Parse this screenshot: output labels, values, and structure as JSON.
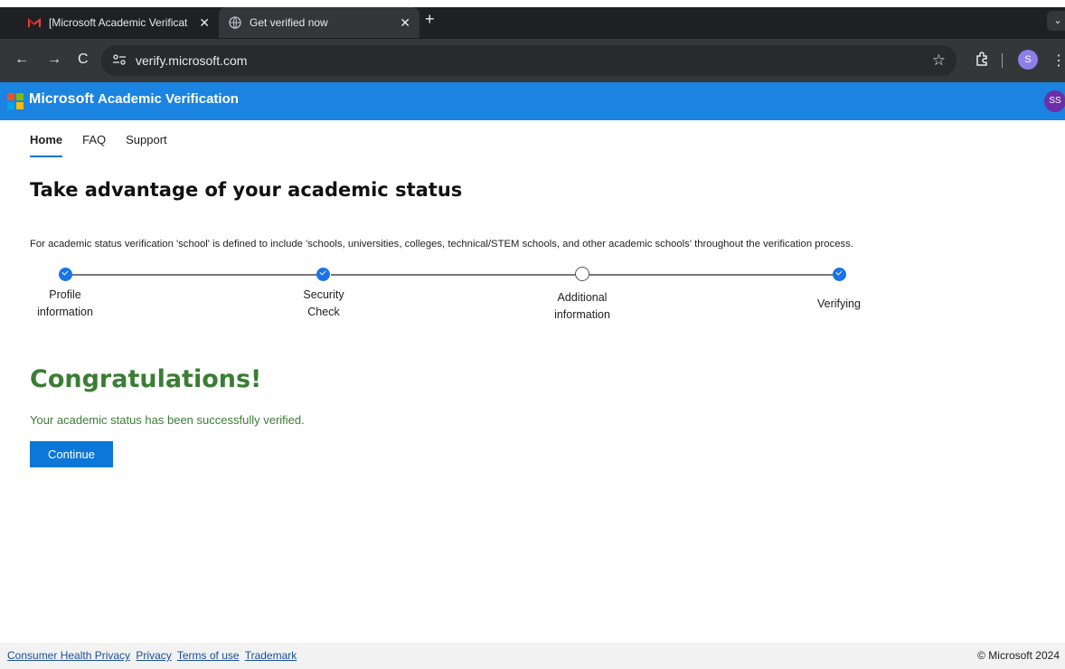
{
  "browser": {
    "tabs": [
      {
        "title": "[Microsoft Academic Verificat",
        "favicon": "gmail-icon"
      },
      {
        "title": "Get verified now",
        "favicon": "globe-icon"
      }
    ],
    "new_tab": "+",
    "url": "verify.microsoft.com",
    "profile_initial": "S"
  },
  "site": {
    "brand": "Microsoft",
    "app_title": "Academic Verification",
    "avatar_initials": "SS",
    "brand_color": "#1b83e0"
  },
  "nav": {
    "items": [
      "Home",
      "FAQ",
      "Support"
    ]
  },
  "main": {
    "title": "Take advantage of your academic status",
    "explanation": "For academic status verification 'school' is defined to include 'schools, universities, colleges, technical/STEM schools, and other academic schools' throughout the verification process.",
    "steps": [
      {
        "line1": "Profile",
        "line2": "information",
        "status": "done"
      },
      {
        "line1": "Security",
        "line2": "Check",
        "status": "done"
      },
      {
        "line1": "Additional",
        "line2": "information",
        "status": "incomplete"
      },
      {
        "line1": "Verifying",
        "line2": "",
        "status": "done"
      }
    ],
    "congrats": "Congratulations!",
    "success_message": "Your academic status has been successfully verified.",
    "continue_label": "Continue"
  },
  "footer": {
    "links": [
      "Consumer Health Privacy",
      "Privacy",
      "Terms of use",
      "Trademark"
    ],
    "copyright": "© Microsoft 2024"
  }
}
